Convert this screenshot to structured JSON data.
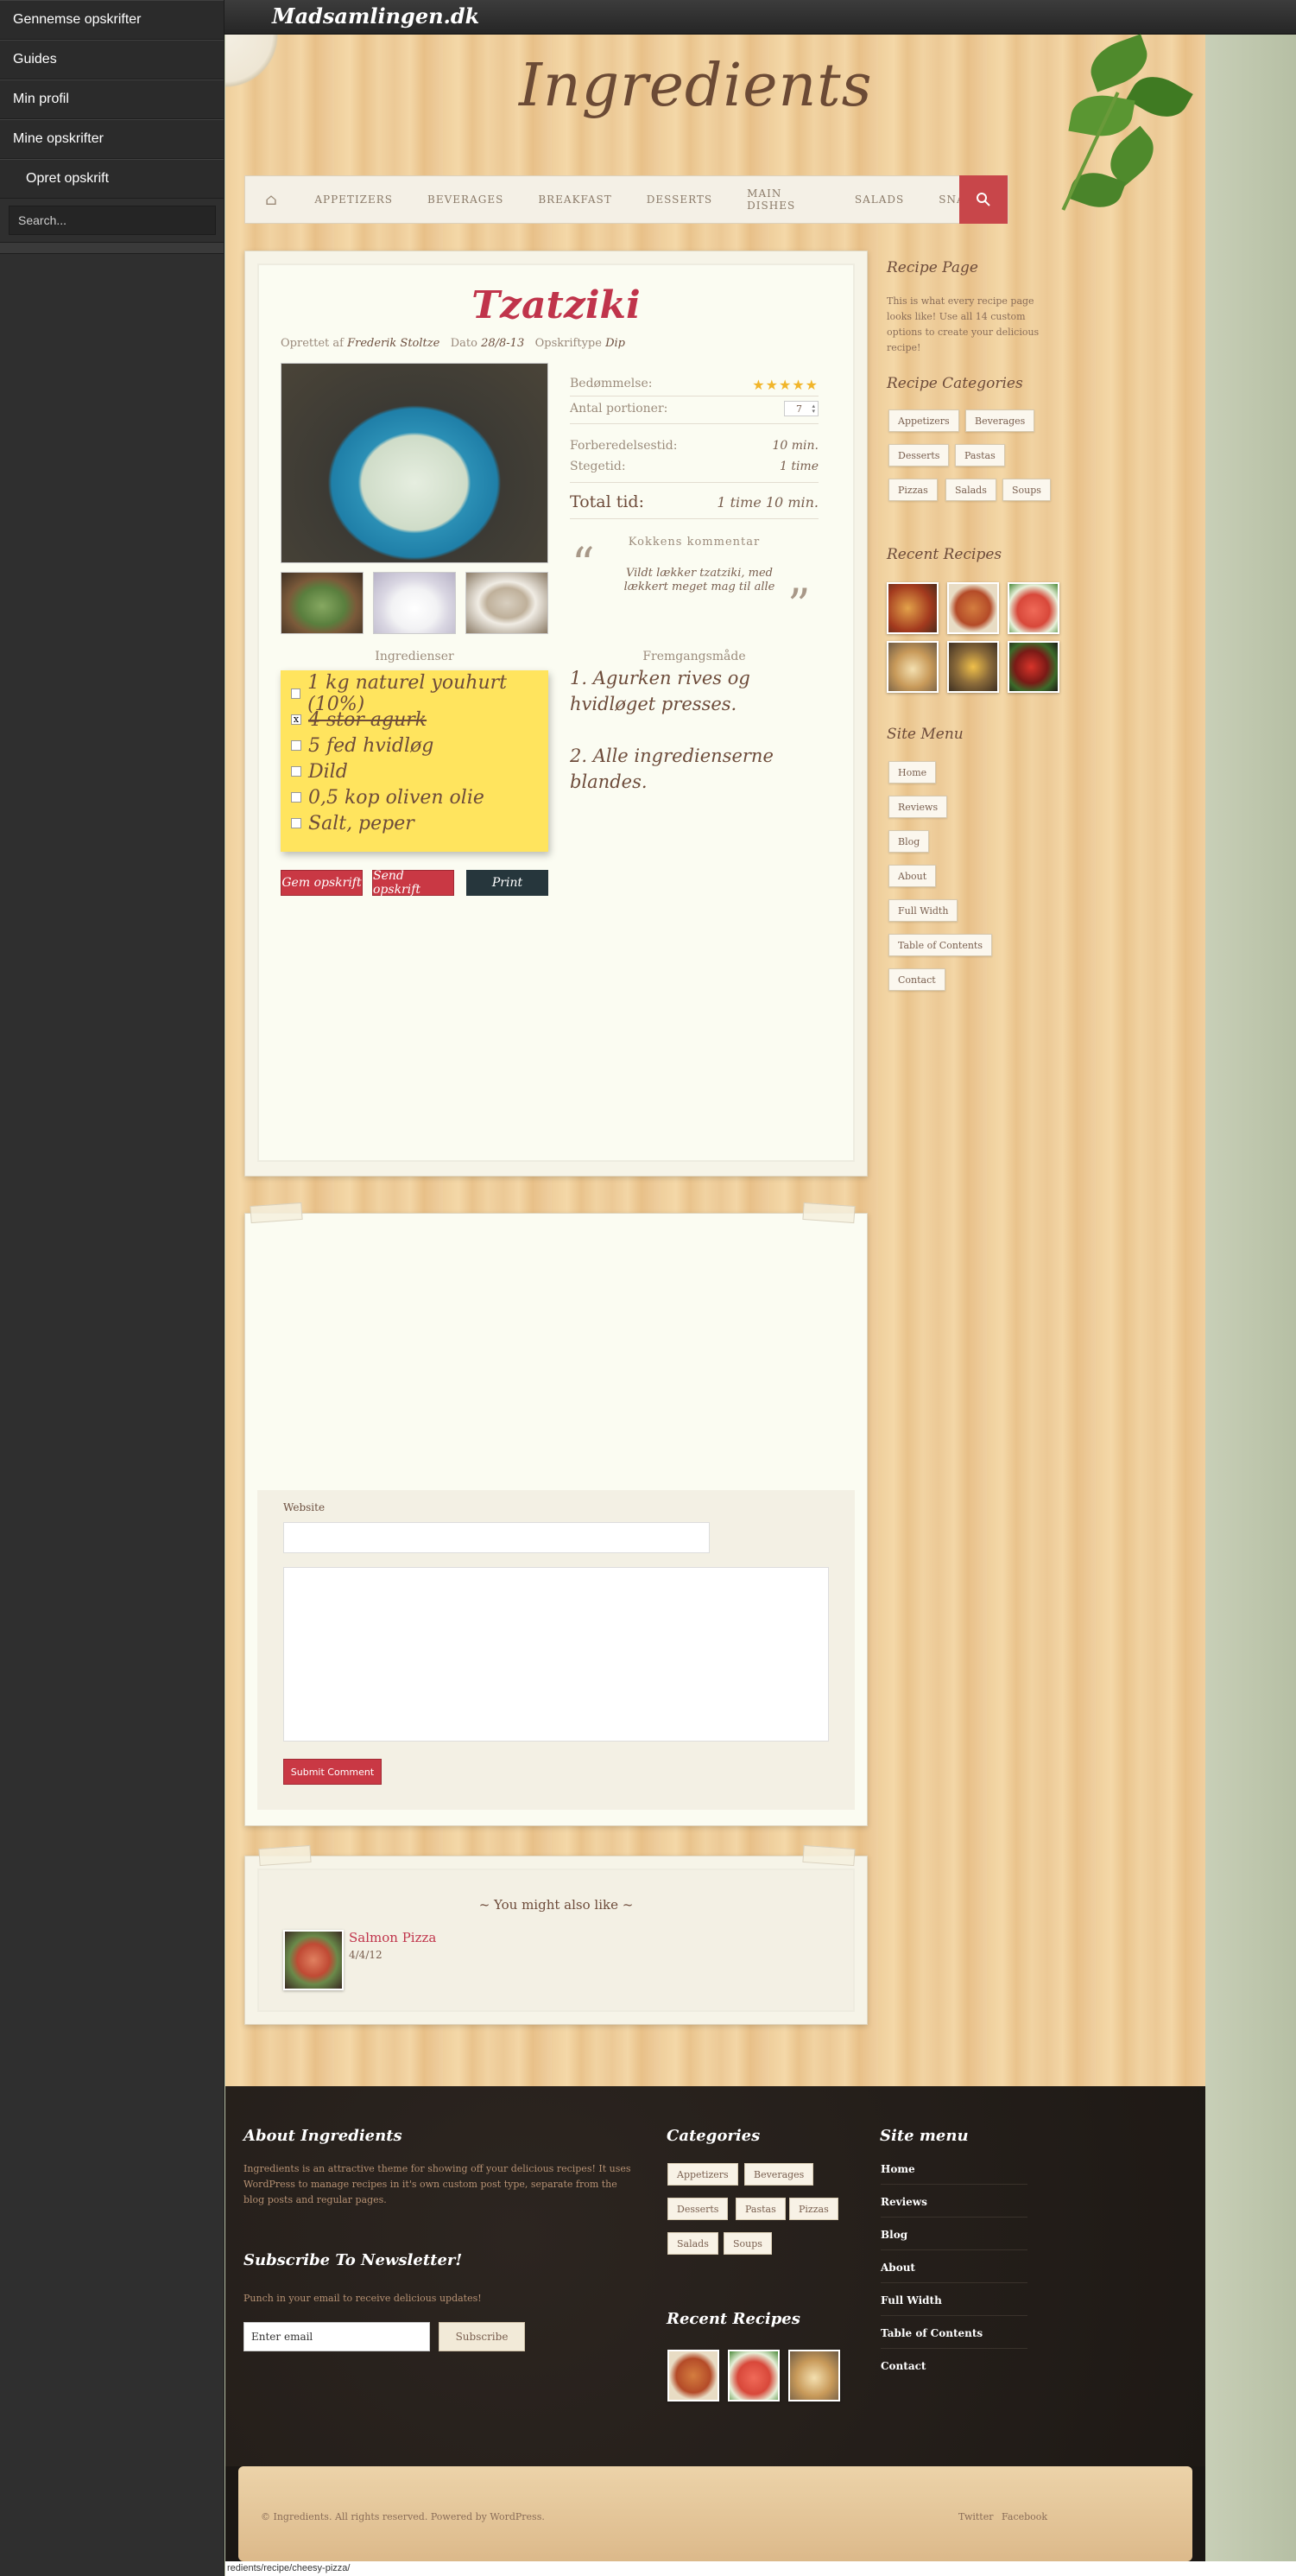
{
  "sidebar": {
    "items": [
      "Gennemse opskrifter",
      "Guides",
      "Min profil",
      "Mine opskrifter",
      "Opret opskrift"
    ],
    "search_placeholder": "Search..."
  },
  "topbar": {
    "site": "Madsamlingen.dk"
  },
  "header": {
    "brand": "Ingredients"
  },
  "nav": {
    "items": [
      "APPETIZERS",
      "BEVERAGES",
      "BREAKFAST",
      "DESSERTS",
      "MAIN DISHES",
      "SALADS",
      "SNACKS"
    ]
  },
  "recipe": {
    "title": "Tzatziki",
    "meta": {
      "created_label": "Oprettet af",
      "author": "Frederik Stoltze",
      "date_label": "Dato",
      "date": "28/8-13",
      "type_label": "Opskriftype",
      "type": "Dip"
    },
    "rating_label": "Bedømmelse:",
    "rating": 5,
    "stars": "★★★★★",
    "servings_label": "Antal portioner:",
    "servings": "7",
    "prep_label": "Forberedelsestid:",
    "prep": "10 min.",
    "cook_label": "Stegetid:",
    "cook": "1 time",
    "total_label": "Total tid:",
    "total": "1 time 10 min.",
    "comment_label": "Kokkens kommentar",
    "comment": "Vildt lækker tzatziki, med lækkert meget mag til alle",
    "ingredients_label": "Ingredienser",
    "method_label": "Fremgangsmåde",
    "ingredients": [
      {
        "text": "1 kg naturel youhurt (10%)",
        "checked": false
      },
      {
        "text": "4 stor agurk",
        "checked": true,
        "check_mark": "x"
      },
      {
        "text": "5 fed hvidløg",
        "checked": false
      },
      {
        "text": "Dild",
        "checked": false
      },
      {
        "text": "0,5 kop oliven olie",
        "checked": false
      },
      {
        "text": "Salt, peper",
        "checked": false
      }
    ],
    "steps": [
      "1. Agurken rives og hvidløget presses.",
      "2. Alle ingredienserne blandes."
    ],
    "buttons": {
      "save": "Gem opskrift",
      "send": "Send opskrift",
      "print": "Print"
    }
  },
  "widgets": {
    "recipe_page_title": "Recipe Page",
    "recipe_page_text": "This is what every recipe page looks like! Use all 14 custom options to create your delicious recipe!",
    "categories_title": "Recipe Categories",
    "categories": [
      "Appetizers",
      "Beverages",
      "Desserts",
      "Pastas",
      "Pizzas",
      "Salads",
      "Soups"
    ],
    "recent_title": "Recent Recipes",
    "menu_title": "Site Menu",
    "menu": [
      "Home",
      "Reviews",
      "Blog",
      "About",
      "Full Width",
      "Table of Contents",
      "Contact"
    ]
  },
  "comment_form": {
    "website_label": "Website",
    "submit": "Submit Comment"
  },
  "related": {
    "title": "~ You might also like ~",
    "item_title": "Salmon Pizza",
    "item_date": "4/4/12"
  },
  "footer": {
    "about_title": "About Ingredients",
    "about_text": "Ingredients is an attractive theme for showing off your delicious recipes! It uses WordPress to manage recipes in it's own custom post type, separate from the blog posts and regular pages.",
    "newsletter_title": "Subscribe To Newsletter!",
    "newsletter_text": "Punch in your email to receive delicious updates!",
    "email_placeholder": "Enter email",
    "subscribe": "Subscribe",
    "categories_title": "Categories",
    "categories": [
      "Appetizers",
      "Beverages",
      "Desserts",
      "Pastas",
      "Pizzas",
      "Salads",
      "Soups"
    ],
    "recent_title": "Recent Recipes",
    "menu_title": "Site menu",
    "menu": [
      "Home",
      "Reviews",
      "Blog",
      "About",
      "Full Width",
      "Table of Contents",
      "Contact"
    ],
    "copyright": "© Ingredients. All rights reserved. Powered by WordPress.",
    "social": [
      "Twitter",
      "Facebook"
    ]
  },
  "status_url": "redients/recipe/cheesy-pizza/"
}
